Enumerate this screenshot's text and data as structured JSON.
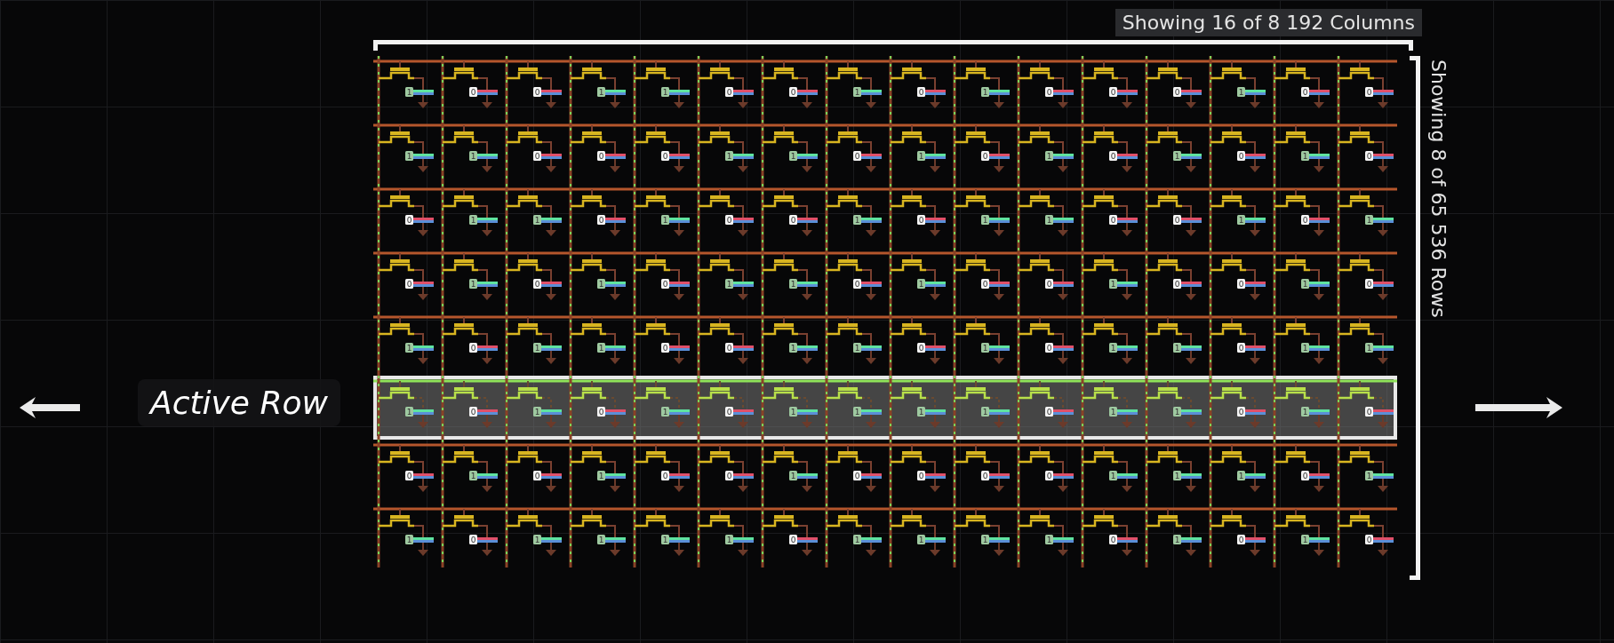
{
  "column_caption": "Showing 16 of 8 192 Columns",
  "row_caption": "Showing 8 of 65 536 Rows",
  "active_row_label": "Active Row",
  "rows": [
    {
      "active": false,
      "cells": [
        {
          "bit": "1",
          "charged": true
        },
        {
          "bit": "0",
          "charged": false
        },
        {
          "bit": "0",
          "charged": false
        },
        {
          "bit": "1",
          "charged": true
        },
        {
          "bit": "1",
          "charged": true
        },
        {
          "bit": "0",
          "charged": false
        },
        {
          "bit": "0",
          "charged": false
        },
        {
          "bit": "1",
          "charged": true
        },
        {
          "bit": "0",
          "charged": false
        },
        {
          "bit": "1",
          "charged": true
        },
        {
          "bit": "0",
          "charged": false
        },
        {
          "bit": "0",
          "charged": false
        },
        {
          "bit": "0",
          "charged": false
        },
        {
          "bit": "1",
          "charged": true
        },
        {
          "bit": "0",
          "charged": false
        },
        {
          "bit": "0",
          "charged": false
        }
      ]
    },
    {
      "active": false,
      "cells": [
        {
          "bit": "1",
          "charged": true
        },
        {
          "bit": "1",
          "charged": true
        },
        {
          "bit": "0",
          "charged": false
        },
        {
          "bit": "0",
          "charged": false
        },
        {
          "bit": "0",
          "charged": false
        },
        {
          "bit": "1",
          "charged": true
        },
        {
          "bit": "1",
          "charged": true
        },
        {
          "bit": "0",
          "charged": false
        },
        {
          "bit": "1",
          "charged": true
        },
        {
          "bit": "0",
          "charged": false
        },
        {
          "bit": "1",
          "charged": true
        },
        {
          "bit": "0",
          "charged": false
        },
        {
          "bit": "1",
          "charged": true
        },
        {
          "bit": "0",
          "charged": false
        },
        {
          "bit": "1",
          "charged": true
        },
        {
          "bit": "0",
          "charged": false
        }
      ]
    },
    {
      "active": false,
      "cells": [
        {
          "bit": "0",
          "charged": false
        },
        {
          "bit": "1",
          "charged": true
        },
        {
          "bit": "1",
          "charged": true
        },
        {
          "bit": "0",
          "charged": false
        },
        {
          "bit": "1",
          "charged": true
        },
        {
          "bit": "0",
          "charged": false
        },
        {
          "bit": "0",
          "charged": false
        },
        {
          "bit": "1",
          "charged": true
        },
        {
          "bit": "0",
          "charged": false
        },
        {
          "bit": "1",
          "charged": true
        },
        {
          "bit": "1",
          "charged": true
        },
        {
          "bit": "0",
          "charged": false
        },
        {
          "bit": "0",
          "charged": false
        },
        {
          "bit": "1",
          "charged": true
        },
        {
          "bit": "0",
          "charged": false
        },
        {
          "bit": "1",
          "charged": true
        }
      ]
    },
    {
      "active": false,
      "cells": [
        {
          "bit": "0",
          "charged": false
        },
        {
          "bit": "1",
          "charged": true
        },
        {
          "bit": "0",
          "charged": false
        },
        {
          "bit": "1",
          "charged": true
        },
        {
          "bit": "0",
          "charged": false
        },
        {
          "bit": "1",
          "charged": true
        },
        {
          "bit": "1",
          "charged": true
        },
        {
          "bit": "0",
          "charged": false
        },
        {
          "bit": "1",
          "charged": true
        },
        {
          "bit": "0",
          "charged": false
        },
        {
          "bit": "0",
          "charged": false
        },
        {
          "bit": "1",
          "charged": true
        },
        {
          "bit": "0",
          "charged": false
        },
        {
          "bit": "0",
          "charged": false
        },
        {
          "bit": "1",
          "charged": true
        },
        {
          "bit": "0",
          "charged": false
        }
      ]
    },
    {
      "active": false,
      "cells": [
        {
          "bit": "1",
          "charged": true
        },
        {
          "bit": "0",
          "charged": false
        },
        {
          "bit": "1",
          "charged": true
        },
        {
          "bit": "1",
          "charged": true
        },
        {
          "bit": "0",
          "charged": false
        },
        {
          "bit": "0",
          "charged": false
        },
        {
          "bit": "1",
          "charged": true
        },
        {
          "bit": "1",
          "charged": true
        },
        {
          "bit": "0",
          "charged": false
        },
        {
          "bit": "1",
          "charged": true
        },
        {
          "bit": "0",
          "charged": false
        },
        {
          "bit": "1",
          "charged": true
        },
        {
          "bit": "1",
          "charged": true
        },
        {
          "bit": "0",
          "charged": false
        },
        {
          "bit": "1",
          "charged": true
        },
        {
          "bit": "1",
          "charged": true
        }
      ]
    },
    {
      "active": true,
      "cells": [
        {
          "bit": "1",
          "charged": true
        },
        {
          "bit": "0",
          "charged": false
        },
        {
          "bit": "1",
          "charged": true
        },
        {
          "bit": "0",
          "charged": false
        },
        {
          "bit": "1",
          "charged": true
        },
        {
          "bit": "0",
          "charged": false
        },
        {
          "bit": "1",
          "charged": true
        },
        {
          "bit": "1",
          "charged": true
        },
        {
          "bit": "1",
          "charged": true
        },
        {
          "bit": "1",
          "charged": true
        },
        {
          "bit": "0",
          "charged": false
        },
        {
          "bit": "1",
          "charged": true
        },
        {
          "bit": "1",
          "charged": true
        },
        {
          "bit": "0",
          "charged": false
        },
        {
          "bit": "1",
          "charged": true
        },
        {
          "bit": "0",
          "charged": false
        }
      ]
    },
    {
      "active": false,
      "cells": [
        {
          "bit": "0",
          "charged": false
        },
        {
          "bit": "1",
          "charged": true
        },
        {
          "bit": "0",
          "charged": false
        },
        {
          "bit": "1",
          "charged": true
        },
        {
          "bit": "0",
          "charged": false
        },
        {
          "bit": "0",
          "charged": false
        },
        {
          "bit": "1",
          "charged": true
        },
        {
          "bit": "0",
          "charged": false
        },
        {
          "bit": "0",
          "charged": false
        },
        {
          "bit": "0",
          "charged": false
        },
        {
          "bit": "0",
          "charged": false
        },
        {
          "bit": "1",
          "charged": true
        },
        {
          "bit": "1",
          "charged": true
        },
        {
          "bit": "1",
          "charged": true
        },
        {
          "bit": "0",
          "charged": false
        },
        {
          "bit": "1",
          "charged": true
        }
      ]
    },
    {
      "active": false,
      "cells": [
        {
          "bit": "1",
          "charged": true
        },
        {
          "bit": "0",
          "charged": false
        },
        {
          "bit": "1",
          "charged": true
        },
        {
          "bit": "1",
          "charged": true
        },
        {
          "bit": "1",
          "charged": true
        },
        {
          "bit": "1",
          "charged": true
        },
        {
          "bit": "0",
          "charged": false
        },
        {
          "bit": "1",
          "charged": true
        },
        {
          "bit": "1",
          "charged": true
        },
        {
          "bit": "1",
          "charged": true
        },
        {
          "bit": "1",
          "charged": true
        },
        {
          "bit": "0",
          "charged": false
        },
        {
          "bit": "1",
          "charged": true
        },
        {
          "bit": "0",
          "charged": false
        },
        {
          "bit": "1",
          "charged": true
        },
        {
          "bit": "0",
          "charged": false
        }
      ]
    }
  ]
}
